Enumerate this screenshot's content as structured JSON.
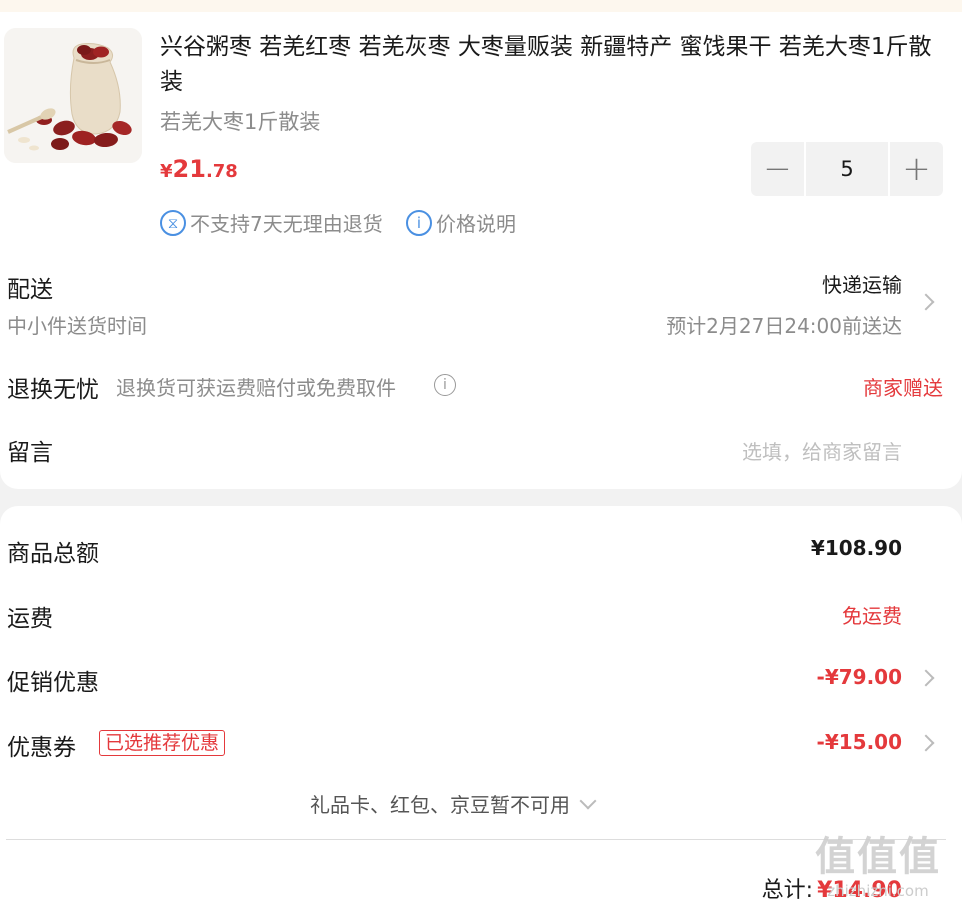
{
  "product": {
    "title": "兴谷粥枣 若羌红枣 若羌灰枣 大枣量贩装 新疆特产 蜜饯果干 若羌大枣1斤散装",
    "spec": "若羌大枣1斤散装",
    "price_symbol": "¥",
    "price_int": "21",
    "price_dec": ".78",
    "quantity": "5",
    "no_return_text": "不支持7天无理由退货",
    "price_note_text": "价格说明"
  },
  "delivery": {
    "label": "配送",
    "sub": "中小件送货时间",
    "method": "快递运输",
    "eta": "预计2月27日24:00前送达"
  },
  "returns": {
    "label": "退换无忧",
    "desc": "退换货可获运费赔付或免费取件",
    "status": "商家赠送"
  },
  "message": {
    "label": "留言",
    "placeholder": "选填，给商家留言"
  },
  "summary": {
    "goods_total_label": "商品总额",
    "goods_total_value": "¥108.90",
    "shipping_label": "运费",
    "shipping_value": "免运费",
    "promo_label": "促销优惠",
    "promo_value": "-¥79.00",
    "coupon_label": "优惠券",
    "coupon_tag": "已选推荐优惠",
    "coupon_value": "-¥15.00",
    "gift_note": "礼品卡、红包、京豆暂不可用",
    "total_label": "总计:",
    "total_value": "¥14.90"
  },
  "watermark": {
    "text": "值值值",
    "url": "zhizhizhi.com"
  },
  "colors": {
    "accent_red": "#e4393c",
    "info_blue": "#4a90e2"
  }
}
